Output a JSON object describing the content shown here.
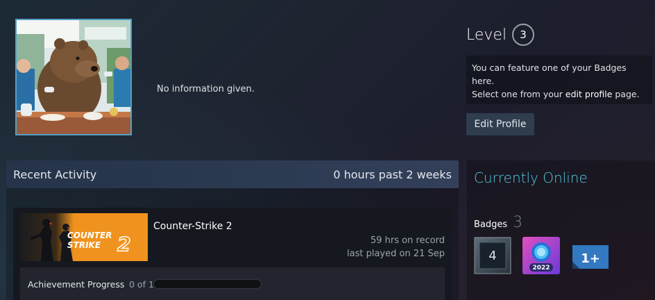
{
  "profile": {
    "summary": "No information given."
  },
  "level": {
    "label": "Level",
    "value": "3"
  },
  "badge_hint": {
    "line1": "You can feature one of your Badges here.",
    "line2_prefix": "Select one from your ",
    "line2_link": "edit profile",
    "line2_suffix": " page."
  },
  "edit_button": {
    "label": "Edit Profile"
  },
  "recent_activity": {
    "title": "Recent Activity",
    "hours": "0 hours past 2 weeks",
    "games": [
      {
        "name": "Counter-Strike 2",
        "capsule_text_1": "COUNTER",
        "capsule_text_2": "STRIKE",
        "capsule_text_3": "2",
        "hours_on_record": "59 hrs on record",
        "last_played": "last played on 21 Sep",
        "achievement_label": "Achievement Progress",
        "achievement_count": "0 of 1",
        "achievement_progress": 0
      }
    ]
  },
  "side": {
    "status": "Currently Online",
    "badges_label": "Badges",
    "badges_count": "3",
    "badge_items": [
      {
        "icon": "years-of-service-badge",
        "text": "4"
      },
      {
        "icon": "steam-replay-2022-badge",
        "text": "2022"
      },
      {
        "icon": "one-plus-badge",
        "text": "1+"
      }
    ]
  },
  "colors": {
    "online": "#57cbde",
    "capsule_orange": "#f0931e",
    "avatar_border": "#57a0c4"
  }
}
